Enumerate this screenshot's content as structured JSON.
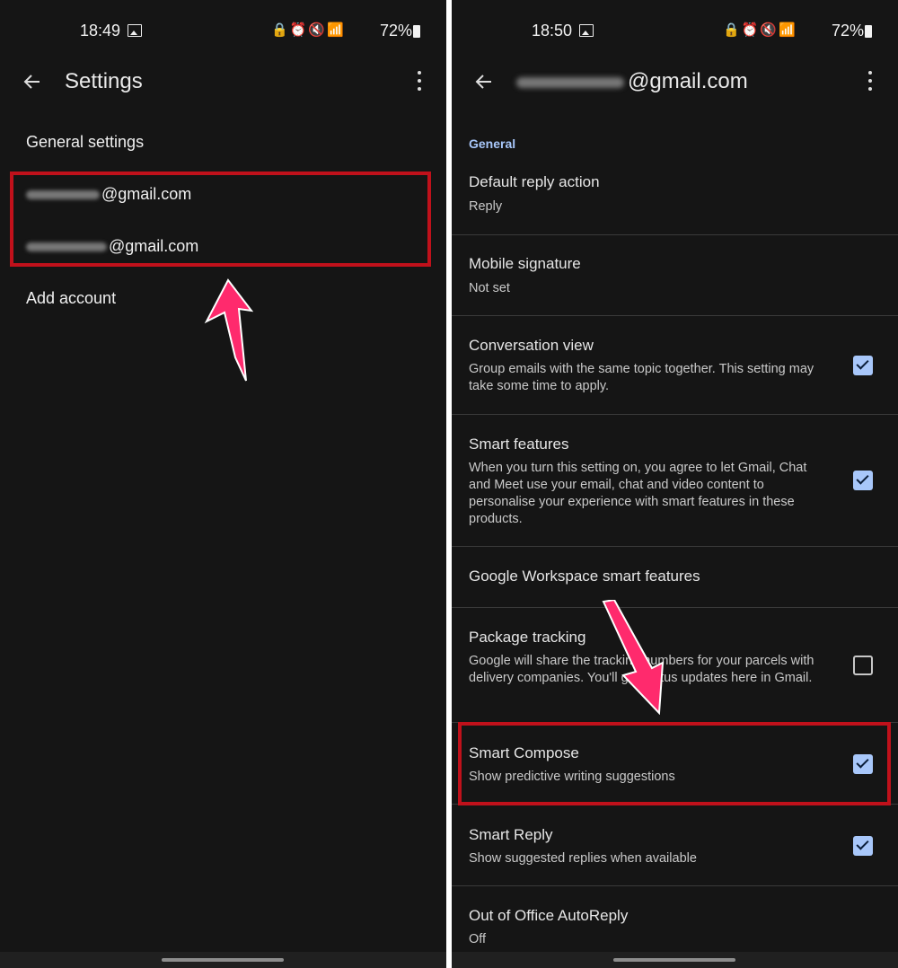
{
  "left": {
    "status": {
      "time": "18:49",
      "battery": "72%"
    },
    "header": {
      "title": "Settings"
    },
    "rows": {
      "general": "General settings",
      "account1": "@gmail.com",
      "account2": "@gmail.com",
      "add": "Add account"
    }
  },
  "right": {
    "status": {
      "time": "18:50",
      "battery": "72%"
    },
    "header": {
      "title_suffix": "@gmail.com"
    },
    "section": "General",
    "items": [
      {
        "title": "Default reply action",
        "subtitle": "Reply"
      },
      {
        "title": "Mobile signature",
        "subtitle": "Not set"
      },
      {
        "title": "Conversation view",
        "subtitle": "Group emails with the same topic together. This setting may take some time to apply.",
        "checked": true
      },
      {
        "title": "Smart features",
        "subtitle": "When you turn this setting on, you agree to let Gmail, Chat and Meet use your email, chat and video content to personalise your experience with smart features in these products.",
        "checked": true
      },
      {
        "title": "Google Workspace smart features",
        "subtitle": ""
      },
      {
        "title": "Package tracking",
        "subtitle": "Google will share the tracking numbers for your parcels with delivery companies. You'll get status updates here in Gmail.",
        "checked": false
      },
      {
        "title": "Smart Compose",
        "subtitle": "Show predictive writing suggestions",
        "checked": true
      },
      {
        "title": "Smart Reply",
        "subtitle": "Show suggested replies when available",
        "checked": true
      },
      {
        "title": "Out of Office AutoReply",
        "subtitle": "Off"
      }
    ]
  },
  "colors": {
    "background": "#151515",
    "accent": "#a8c7fa",
    "highlight": "#c0111b",
    "arrow": "#ff2a6d"
  }
}
